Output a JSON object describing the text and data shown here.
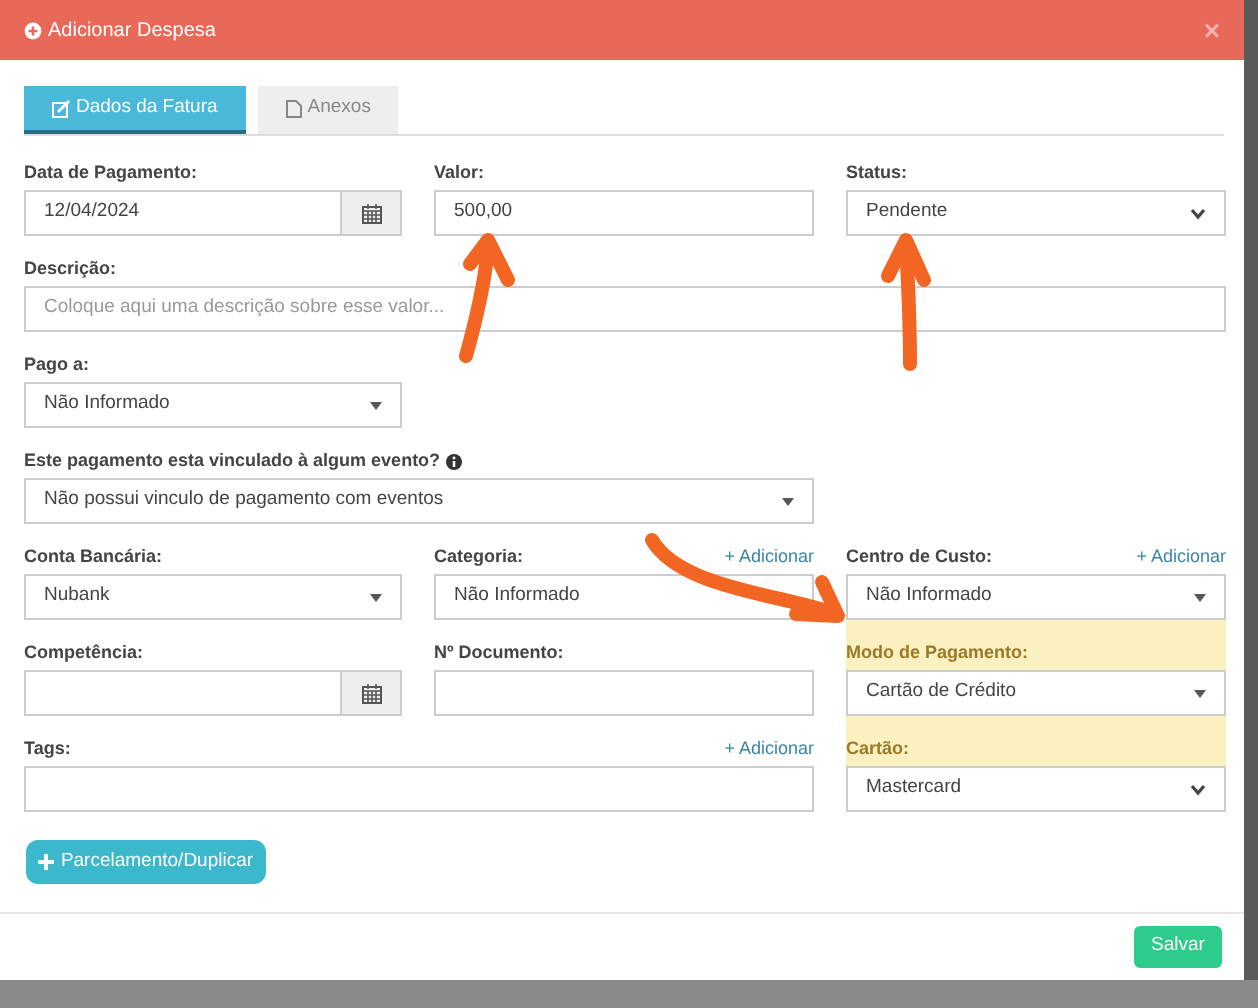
{
  "modal": {
    "title": "Adicionar Despesa",
    "close": "×"
  },
  "tabs": [
    {
      "label": "Dados da Fatura",
      "selected": true
    },
    {
      "label": "Anexos",
      "selected": false
    }
  ],
  "fields": [
    {
      "label": "Data de Pagamento:",
      "kind": "date",
      "value": "12/04/2024",
      "info": false,
      "highlighted": false
    },
    {
      "label": "Valor:",
      "kind": "text",
      "value": "500,00",
      "info": false,
      "highlighted": false
    },
    {
      "label": "Status:",
      "kind": "select",
      "value": "Pendente",
      "info": false,
      "highlighted": false
    },
    {
      "label": "Descrição:",
      "kind": "text",
      "placeholder": "Coloque aqui uma descrição sobre esse valor...",
      "info": false,
      "highlighted": false
    },
    {
      "label": "Pago a:",
      "kind": "dropdown",
      "value": "Não Informado",
      "info": false,
      "highlighted": false
    },
    {
      "label": "Este pagamento esta vinculado à algum evento?",
      "kind": "dropdown",
      "value": "Não possui vinculo de pagamento com eventos",
      "info": true,
      "highlighted": false
    },
    {
      "label": "Conta Bancária:",
      "kind": "dropdown",
      "value": "Nubank",
      "info": false,
      "highlighted": false
    },
    {
      "label": "Categoria:",
      "kind": "text",
      "value": "Não Informado",
      "add": "+ Adicionar",
      "info": false,
      "highlighted": false
    },
    {
      "label": "Centro de Custo:",
      "kind": "dropdown",
      "value": "Não Informado",
      "add": "+ Adicionar",
      "info": false,
      "highlighted": false
    },
    {
      "label": "Competência:",
      "kind": "date",
      "info": false,
      "highlighted": false
    },
    {
      "label": "Nº Documento:",
      "kind": "text",
      "info": false,
      "highlighted": false
    },
    {
      "label": "Modo de Pagamento:",
      "kind": "dropdown",
      "value": "Cartão de Crédito",
      "info": false,
      "highlighted": true
    },
    {
      "label": "Tags:",
      "kind": "text",
      "add": "+ Adicionar",
      "info": false,
      "highlighted": false
    },
    {
      "label": "Cartão:",
      "kind": "select",
      "value": "Mastercard",
      "info": false,
      "highlighted": true
    }
  ],
  "secondary_button": "Parcelamento/Duplicar",
  "primary_button": "Salvar"
}
